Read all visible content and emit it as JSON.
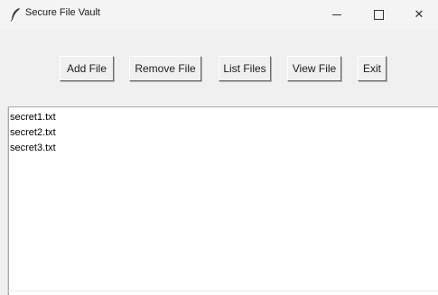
{
  "window": {
    "title": "Secure File Vault",
    "icon": "feather-icon",
    "controls": {
      "minimize": "minimize-icon",
      "maximize": "maximize-icon",
      "close": "close-icon",
      "close_glyph": "✕"
    }
  },
  "toolbar": {
    "add_label": "Add File",
    "remove_label": "Remove File",
    "list_label": "List Files",
    "view_label": "View File",
    "exit_label": "Exit"
  },
  "file_list": {
    "items": [
      "secret1.txt",
      "secret2.txt",
      "secret3.txt"
    ]
  }
}
